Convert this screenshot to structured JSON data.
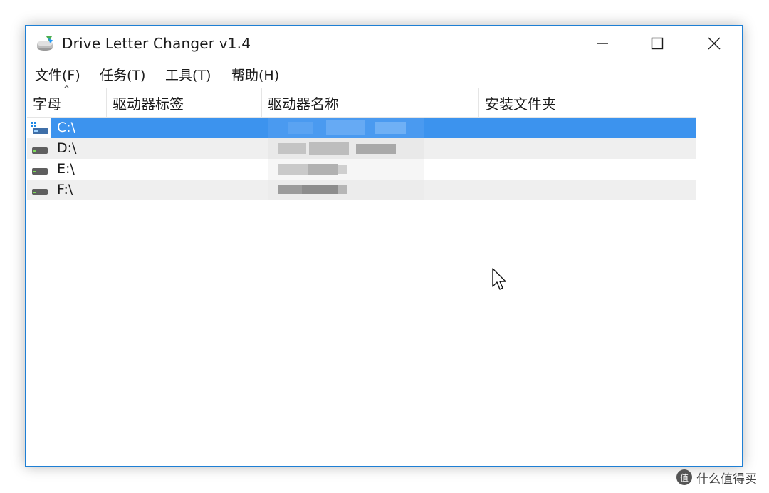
{
  "window": {
    "title": "Drive Letter Changer v1.4",
    "icon": "drive-letter-changer-icon",
    "controls": {
      "minimize": "minimize-icon",
      "maximize": "maximize-icon",
      "close": "close-icon"
    }
  },
  "menu": [
    {
      "label": "文件(F)"
    },
    {
      "label": "任务(T)"
    },
    {
      "label": "工具(T)"
    },
    {
      "label": "帮助(H)"
    }
  ],
  "columns": [
    {
      "label": "字母",
      "sorted": "ascending"
    },
    {
      "label": "驱动器标签"
    },
    {
      "label": "驱动器名称"
    },
    {
      "label": "安装文件夹"
    }
  ],
  "rows": [
    {
      "letter": "C:\\",
      "selected": true,
      "icon": "system-drive-icon"
    },
    {
      "letter": "D:\\",
      "selected": false,
      "icon": "hard-drive-icon"
    },
    {
      "letter": "E:\\",
      "selected": false,
      "icon": "hard-drive-icon"
    },
    {
      "letter": "F:\\",
      "selected": false,
      "icon": "hard-drive-icon"
    }
  ],
  "watermark": {
    "text": "什么值得买",
    "badge": "值"
  },
  "colors": {
    "accent_border": "#1e7fd4",
    "selection": "#3c93ee",
    "alt_row": "#efefef"
  }
}
